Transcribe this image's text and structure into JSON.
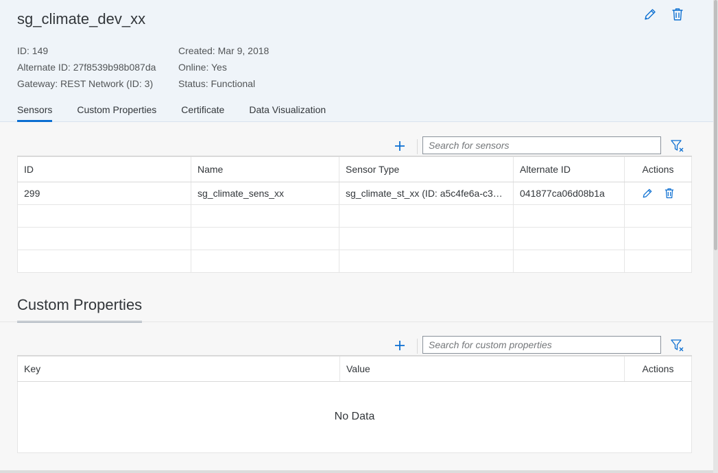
{
  "device": {
    "title": "sg_climate_dev_xx",
    "id": "ID: 149",
    "alternate_id": "Alternate ID: 27f8539b98b087da",
    "gateway": "Gateway: REST Network (ID: 3)",
    "created": "Created: Mar 9, 2018",
    "online": "Online: Yes",
    "status": "Status: Functional"
  },
  "header_icons": {
    "edit": "pencil-icon",
    "delete": "trash-icon"
  },
  "tabs": [
    {
      "label": "Sensors",
      "active": true
    },
    {
      "label": "Custom Properties",
      "active": false
    },
    {
      "label": "Certificate",
      "active": false
    },
    {
      "label": "Data Visualization",
      "active": false
    }
  ],
  "sensors": {
    "search_placeholder": "Search for sensors",
    "columns": [
      "ID",
      "Name",
      "Sensor Type",
      "Alternate ID",
      "Actions"
    ],
    "rows": [
      {
        "id": "299",
        "name": "sg_climate_sens_xx",
        "sensor_type": "sg_climate_st_xx (ID: a5c4fe6a-c32…",
        "alternate_id": "041877ca06d08b1a"
      }
    ]
  },
  "custom_properties": {
    "section_title": "Custom Properties",
    "search_placeholder": "Search for custom properties",
    "columns": [
      "Key",
      "Value",
      "Actions"
    ],
    "empty_text": "No Data"
  },
  "colors": {
    "accent": "#0a6ed1",
    "header_bg": "#eff4f9",
    "icon": "#0a6ed1"
  }
}
